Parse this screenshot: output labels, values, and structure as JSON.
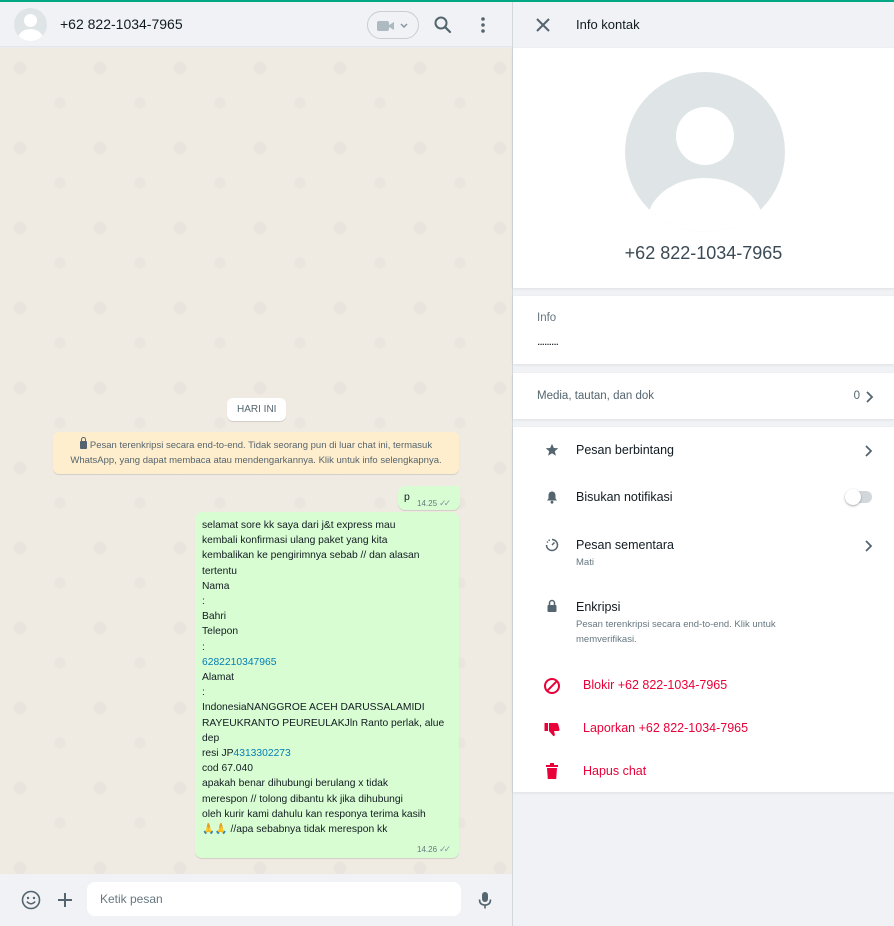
{
  "chat": {
    "contact_name": "+62 822-1034-7965",
    "date_chip": "HARI INI",
    "encryption_notice": "Pesan terenkripsi secara end-to-end. Tidak seorang pun di luar chat ini, termasuk WhatsApp, yang dapat membaca atau mendengarkannya. Klik untuk info selengkapnya.",
    "messages": [
      {
        "text": "p",
        "time": "14.25",
        "status": "read"
      },
      {
        "time": "14.26",
        "status": "read",
        "lines": [
          "selamat sore kk saya dari j&t express mau",
          "kembali konfirmasi ulang paket yang  kita",
          "kembalikan ke pengirimnya sebab // dan alasan",
          "tertentu",
          "Nama",
          ":",
          "Bahri",
          "Telepon",
          ":",
          "6282210347965",
          "Alamat",
          ":",
          "IndonesiaNANGGROE ACEH DARUSSALAMIDI",
          "RAYEUKRANTO PEUREULAKJln Ranto perlak, alue",
          "dep",
          "resi JP",
          "4313302273",
          "cod 67.040",
          "apakah benar dihubungi berulang x tidak",
          "merespon  // tolong dibantu kk jika dihubungi",
          "oleh kurir kami dahulu kan responya terima kasih",
          "🙏🙏  //apa sebabnya tidak merespon kk"
        ]
      }
    ],
    "composer_placeholder": "Ketik pesan"
  },
  "info_panel": {
    "title": "Info kontak",
    "name": "+62 822-1034-7965",
    "about_label": "Info",
    "about_value": ".........",
    "media_label": "Media, tautan, dan dok",
    "media_count": "0",
    "starred_label": "Pesan berbintang",
    "mute_label": "Bisukan notifikasi",
    "mute_on": false,
    "disappearing_label": "Pesan sementara",
    "disappearing_value": "Mati",
    "encryption_label": "Enkripsi",
    "encryption_desc": "Pesan terenkripsi secara end-to-end. Klik untuk memverifikasi.",
    "block_label": "Blokir +62 822-1034-7965",
    "report_label": "Laporkan +62 822-1034-7965",
    "delete_label": "Hapus chat"
  },
  "colors": {
    "accent": "#00a884",
    "outgoing_bubble": "#d9fdd3",
    "danger": "#ea0038",
    "link": "#027eb5",
    "notice_bg": "#ffeecd"
  }
}
